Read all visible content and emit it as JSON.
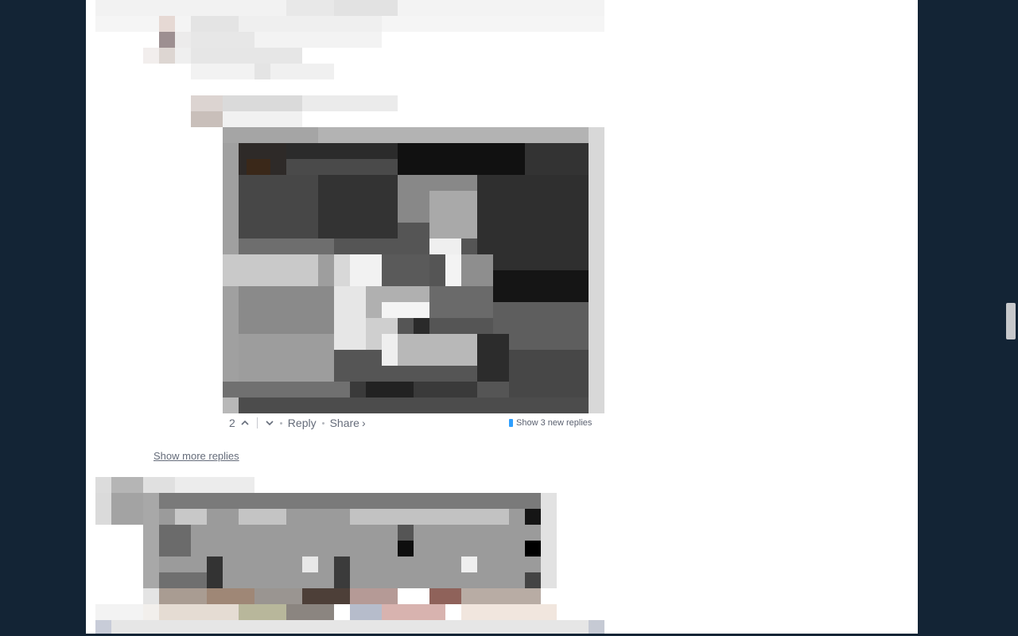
{
  "comment": {
    "vote_count": "2",
    "reply_label": "Reply",
    "share_label": "Share",
    "share_chevron": "›",
    "new_replies_label": "Show 3 new replies"
  },
  "thread": {
    "show_more_replies_label": "Show more replies"
  },
  "icons": {
    "upvote": "chevron-up-icon",
    "downvote": "chevron-down-icon",
    "new_indicator": "blue-dot-icon"
  },
  "colors": {
    "page_background": "#132435",
    "content_background": "#ffffff",
    "meta_text": "#656c7a",
    "new_reply_badge": "#2e9fff"
  }
}
